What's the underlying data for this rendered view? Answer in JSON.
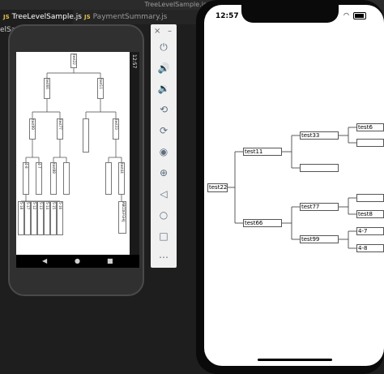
{
  "editor": {
    "window_title": "TreeLevelSample.js — sunoar",
    "tabs": [
      {
        "label": "TreeLevelSample.js",
        "badge": "JS"
      },
      {
        "label": "PaymentSummary.js",
        "badge": "JS"
      }
    ],
    "sidebar_fragment": "elSam"
  },
  "android": {
    "status_time": "12:57",
    "nav": [
      "back-icon",
      "home-icon",
      "recents-icon"
    ],
    "tree_labels": [
      "test22",
      "test66",
      "test11",
      "test99",
      "test77",
      "test33",
      "test88",
      "test44",
      "4-8",
      "4-7",
      "5-18",
      "5-17",
      "5-12",
      "5-13",
      "5-14",
      "5-15",
      "5-16",
      "ABCDEFGHIJ"
    ]
  },
  "toolbar": {
    "close": "×",
    "minimize": "–",
    "icons": [
      "power-icon",
      "volume-up-icon",
      "volume-down-icon",
      "rotate-left-icon",
      "rotate-right-icon",
      "camera-icon",
      "zoom-icon",
      "back-icon",
      "home-icon",
      "overview-icon",
      "more-icon"
    ]
  },
  "iphone": {
    "time": "12:57",
    "nodes": {
      "root": "test22",
      "n11": "test11",
      "n66": "test66",
      "n33": "test33",
      "n77": "test77",
      "n99": "test99",
      "t6": "test6",
      "t8": "test8",
      "n47": "4-7",
      "n48": "4-8"
    }
  }
}
